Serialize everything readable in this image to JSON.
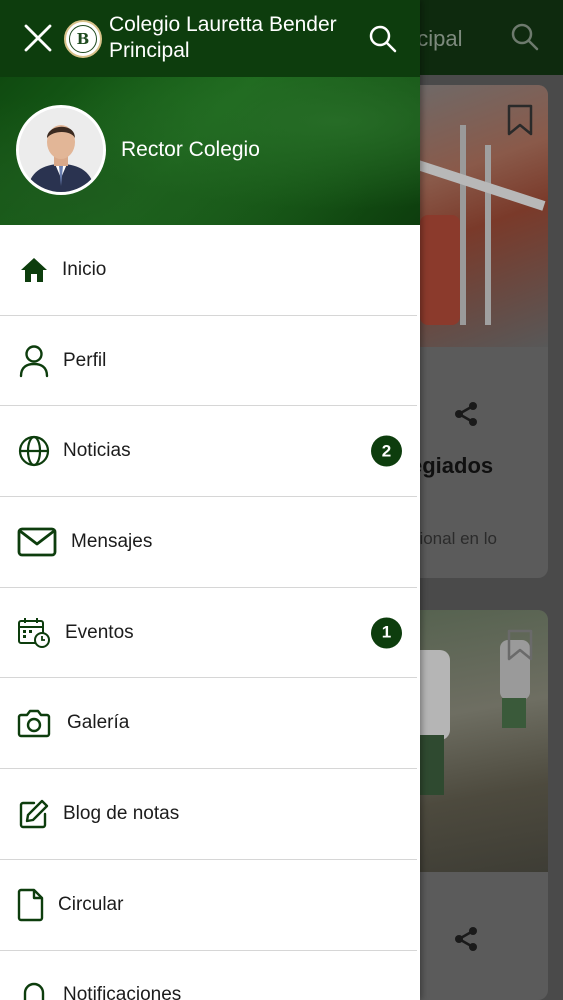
{
  "app": {
    "title": "Colegio Lauretta Bender Principal",
    "logo_monogram": "B",
    "accent_color": "#0d3d0d"
  },
  "background": {
    "title_fragment": "ncipal",
    "card_title_fragment": "egiados",
    "card_text_fragment": "gional en lo"
  },
  "profile": {
    "name": "Rector Colegio"
  },
  "menu": {
    "items": [
      {
        "label": "Inicio",
        "icon": "home-icon"
      },
      {
        "label": "Perfil",
        "icon": "user-icon"
      },
      {
        "label": "Noticias",
        "icon": "globe-icon",
        "badge": "2"
      },
      {
        "label": "Mensajes",
        "icon": "mail-icon"
      },
      {
        "label": "Eventos",
        "icon": "calendar-clock-icon",
        "badge": "1"
      },
      {
        "label": "Galería",
        "icon": "camera-icon"
      },
      {
        "label": "Blog de notas",
        "icon": "edit-icon"
      },
      {
        "label": "Circular",
        "icon": "document-icon"
      },
      {
        "label": "Notificaciones",
        "icon": "bell-icon"
      }
    ]
  }
}
